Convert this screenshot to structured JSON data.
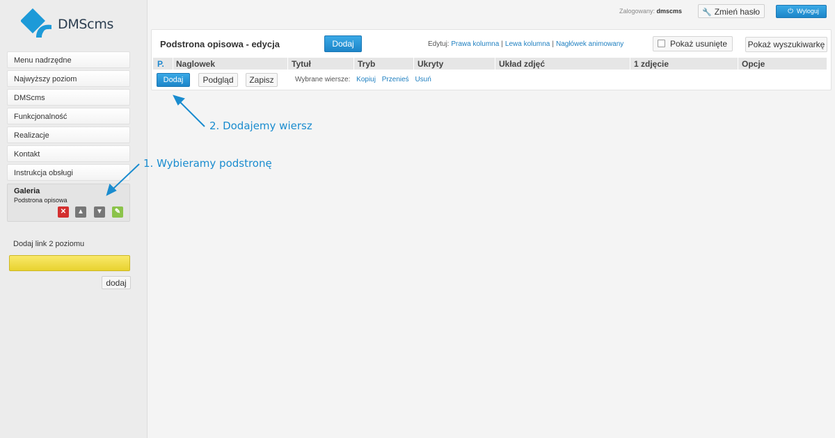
{
  "brand": {
    "name": "DMScms",
    "accent": "#1d86c9",
    "highlight": "#e8d22f"
  },
  "sidebar": {
    "items": [
      {
        "label": "Menu nadrzędne"
      },
      {
        "label": "Najwyższy poziom"
      },
      {
        "label": "DMScms"
      },
      {
        "label": "Funkcjonalność"
      },
      {
        "label": "Realizacje"
      },
      {
        "label": "Kontakt"
      },
      {
        "label": "Instrukcja obsługi"
      }
    ],
    "active": {
      "title": "Galeria",
      "subtitle": "Podstrona opisowa",
      "icons": [
        "delete-icon",
        "move-up-icon",
        "move-down-icon",
        "edit-icon"
      ]
    },
    "add_link": {
      "label": "Dodaj link 2 poziomu",
      "value": "",
      "button": "dodaj"
    }
  },
  "topbar": {
    "logged_label": "Zalogowany:",
    "user": "dmscms",
    "change_password": "Zmień hasło",
    "logout": "Wyloguj"
  },
  "panel": {
    "title": "Podstrona opisowa - edycja",
    "add_button": "Dodaj",
    "edit_label": "Edytuj:",
    "edit_links": [
      "Prawa kolumna",
      "Lewa kolumna",
      "Nagłówek animowany"
    ],
    "show_deleted": "Pokaż usunięte",
    "show_search": "Pokaż wyszukiwarkę",
    "columns": [
      "P.",
      "Naglowek",
      "Tytuł",
      "Tryb",
      "Ukryty",
      "Układ zdjęć",
      "1 zdjęcie",
      "Opcje"
    ],
    "row_tools": {
      "add": "Dodaj",
      "preview": "Podgląd",
      "save": "Zapisz",
      "selected_label": "Wybrane wiersze:",
      "actions": [
        "Kopiuj",
        "Przenieś",
        "Usuń"
      ]
    }
  },
  "annotations": {
    "step1": "1. Wybieramy podstronę",
    "step2": "2. Dodajemy wiersz"
  }
}
